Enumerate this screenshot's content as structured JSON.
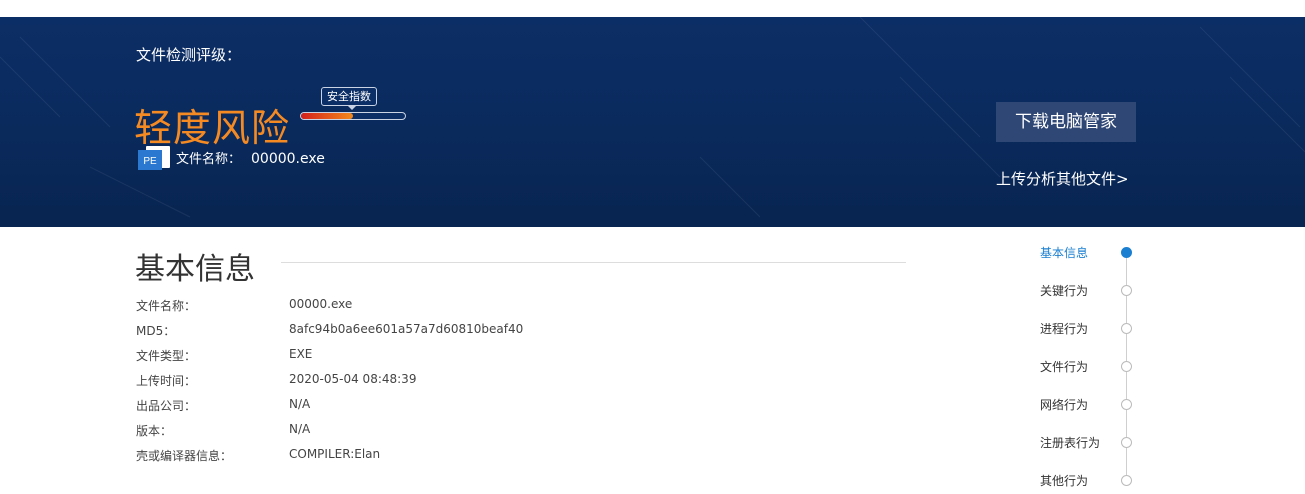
{
  "header": {
    "grade_label": "文件检测评级：",
    "risk_level": "轻度风险",
    "safety_label": "安全指数",
    "safety_index_fraction": 0.5,
    "file_name_label": "文件名称：",
    "file_name": "00000.exe",
    "pe_icon_text": "PE",
    "download_button": "下载电脑管家",
    "upload_link": "上传分析其他文件>"
  },
  "basic_info": {
    "title": "基本信息",
    "rows": [
      {
        "key": "文件名称：",
        "value": "00000.exe"
      },
      {
        "key": "MD5：",
        "value": "8afc94b0a6ee601a57a7d60810beaf40"
      },
      {
        "key": "文件类型：",
        "value": "EXE"
      },
      {
        "key": "上传时间：",
        "value": "2020-05-04 08:48:39"
      },
      {
        "key": "出品公司：",
        "value": "N/A"
      },
      {
        "key": "版本：",
        "value": "N/A"
      },
      {
        "key": "壳或编译器信息：",
        "value": "COMPILER:Elan"
      }
    ]
  },
  "side_nav": {
    "items": [
      {
        "label": "基本信息"
      },
      {
        "label": "关键行为"
      },
      {
        "label": "进程行为"
      },
      {
        "label": "文件行为"
      },
      {
        "label": "网络行为"
      },
      {
        "label": "注册表行为"
      },
      {
        "label": "其他行为"
      }
    ],
    "active_index": 0
  },
  "colors": {
    "banner": "#0c2e66",
    "risk": "#f58a23",
    "accent": "#1a7fd0"
  }
}
